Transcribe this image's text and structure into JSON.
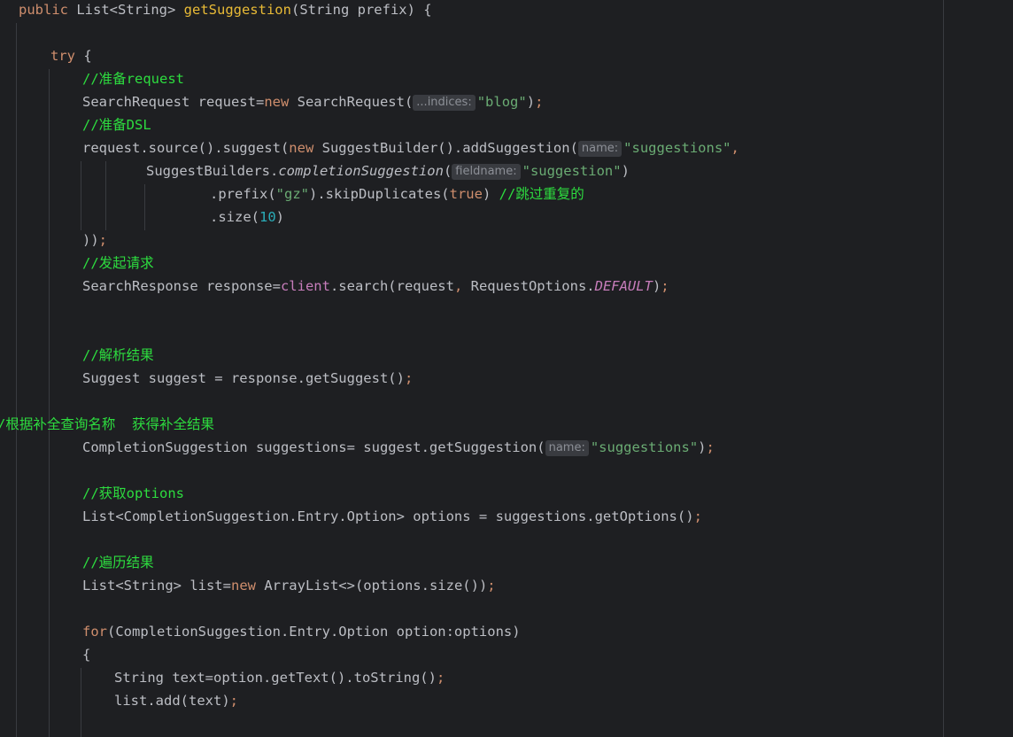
{
  "editor": {
    "theme_colors": {
      "background": "#1e1f22",
      "keyword": "#cf8e6d",
      "string": "#6aab73",
      "number": "#2aacb8",
      "comment": "#2ddc3f",
      "field": "#c77dbb",
      "method_decl": "#e8ba36",
      "hint_bg": "#393b40"
    },
    "lines": {
      "l1": {
        "kw": "public",
        "t1": " List<String> ",
        "decl": "getSuggestion",
        "t2": "(String prefix) {"
      },
      "l2": {
        "kw": "try",
        "t1": " {"
      },
      "l3": {
        "cmt": "//准备request"
      },
      "l4": {
        "t1": "SearchRequest request=",
        "kw": "new",
        "t2": " SearchRequest(",
        "hint": "...indices:",
        "str": "\"blog\"",
        "t3": ")",
        "semi": ";"
      },
      "l5": {
        "cmt": "//准备DSL"
      },
      "l6": {
        "t1": "request.source().suggest(",
        "kw": "new",
        "t2": " SuggestBuilder().addSuggestion(",
        "hint": "name:",
        "str": "\"suggestions\"",
        "t3": ","
      },
      "l7": {
        "t1": "SuggestBuilders.",
        "ital": "completionSuggestion",
        "t2": "(",
        "hint": "fieldname:",
        "str": "\"suggestion\"",
        "t3": ")"
      },
      "l8": {
        "t1": ".prefix(",
        "str": "\"gz\"",
        "t2": ").skipDuplicates(",
        "kw": "true",
        "t3": ") ",
        "cmt": "//跳过重复的"
      },
      "l9": {
        "t1": ".size(",
        "num": "10",
        "t2": ")"
      },
      "l10": {
        "t1": "))",
        "semi": ";"
      },
      "l11": {
        "cmt": "//发起请求"
      },
      "l12": {
        "t1": "SearchResponse response=",
        "field": "client",
        "t2": ".search(request",
        "comma": ",",
        "t3": " RequestOptions.",
        "static": "DEFAULT",
        "t4": ")",
        "semi": ";"
      },
      "l13": {
        "cmt": "//解析结果"
      },
      "l14": {
        "t1": "Suggest suggest = response.getSuggest()",
        "semi": ";"
      },
      "l15": {
        "cmt": "/根据补全查询名称  获得补全结果"
      },
      "l16": {
        "t1": "CompletionSuggestion suggestions= suggest.getSuggestion(",
        "hint": "name:",
        "str": "\"suggestions\"",
        "t2": ")",
        "semi": ";"
      },
      "l17": {
        "cmt": "//获取options"
      },
      "l18": {
        "t1": "List<CompletionSuggestion.Entry.Option> options = suggestions.getOptions()",
        "semi": ";"
      },
      "l19": {
        "cmt": "//遍历结果"
      },
      "l20": {
        "t1": "List<String> list=",
        "kw": "new",
        "t2": " ArrayList<>(options.size())",
        "semi": ";"
      },
      "l21": {
        "kw": "for",
        "t1": "(CompletionSuggestion.Entry.Option option:options)"
      },
      "l22": {
        "t1": "{"
      },
      "l23": {
        "t1": "String text=option.getText().toString()",
        "semi": ";"
      },
      "l24": {
        "t1": "list.add(text)",
        "semi": ";"
      }
    }
  }
}
